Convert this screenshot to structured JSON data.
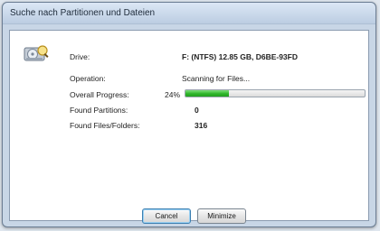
{
  "window": {
    "title": "Suche nach Partitionen und Dateien"
  },
  "icons": {
    "drive": "hard-drive-magnifier-icon"
  },
  "fields": {
    "drive": {
      "label": "Drive:",
      "value": "F: (NTFS) 12.85 GB, D6BE-93FD"
    },
    "operation": {
      "label": "Operation:",
      "value": "Scanning for Files..."
    },
    "overall_progress": {
      "label": "Overall Progress:",
      "percent_text": "24%",
      "percent": 24
    },
    "found_partitions": {
      "label": "Found Partitions:",
      "value": "0"
    },
    "found_files": {
      "label": "Found Files/Folders:",
      "value": "316"
    }
  },
  "buttons": {
    "cancel": "Cancel",
    "minimize": "Minimize"
  },
  "colors": {
    "progress_fill": "#2fb52a",
    "title_bar": "#c8d6e6"
  }
}
